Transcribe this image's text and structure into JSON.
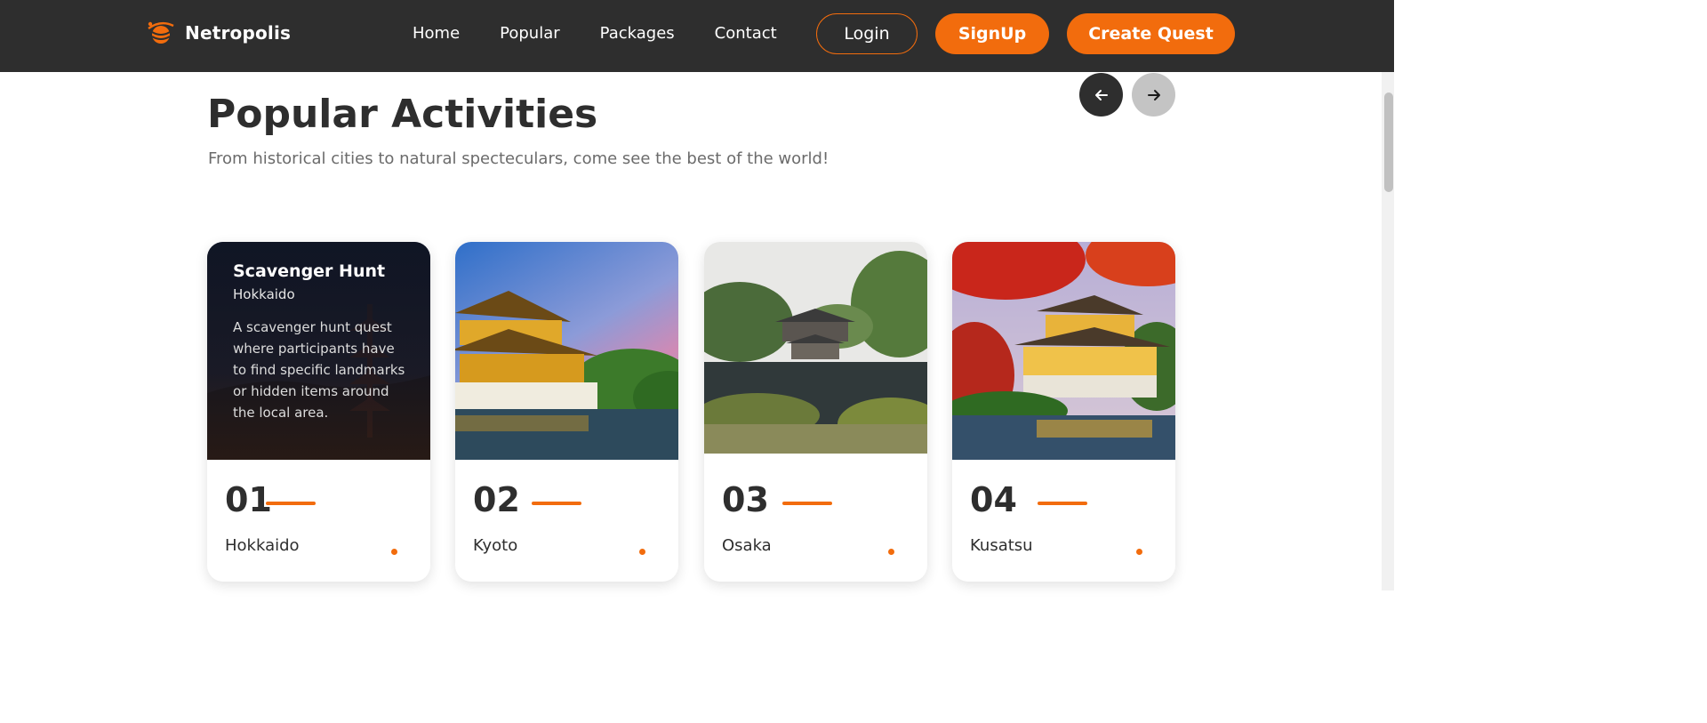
{
  "brand": {
    "name": "Netropolis",
    "accent_color": "#f26c0d",
    "logo_icon": "globe-icon"
  },
  "nav": {
    "links": [
      "Home",
      "Popular",
      "Packages",
      "Contact"
    ]
  },
  "header_buttons": {
    "login": "Login",
    "signup": "SignUp",
    "create": "Create Quest"
  },
  "section": {
    "title": "Popular Activities",
    "subtitle": "From historical cities to natural specteculars, come see the best of the world!",
    "prev_icon": "arrow-left-icon",
    "next_icon": "arrow-right-icon"
  },
  "cards": [
    {
      "number": "01",
      "name": "Hokkaido",
      "overlay": {
        "title": "Scavenger Hunt",
        "location": "Hokkaido",
        "description": "A scavenger hunt quest where participants have to find specific landmarks or hidden items around the local area."
      }
    },
    {
      "number": "02",
      "name": "Kyoto"
    },
    {
      "number": "03",
      "name": "Osaka"
    },
    {
      "number": "04",
      "name": "Kusatsu"
    }
  ],
  "colors": {
    "navbar": "#2e2e2e",
    "accent": "#f26c0d",
    "text_dark": "#2e2e2e",
    "text_muted": "#6b6b6b"
  }
}
